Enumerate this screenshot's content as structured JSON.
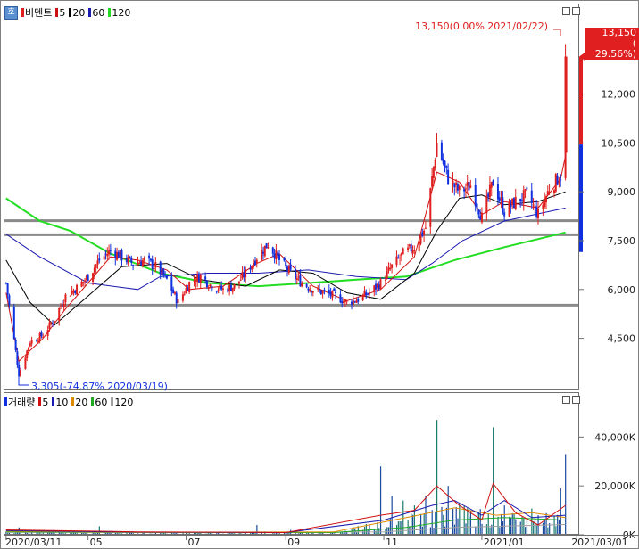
{
  "price_legend": {
    "icon": "호",
    "title": "비덴트",
    "ma5": "5",
    "ma20": "20",
    "ma60": "60",
    "ma120": "120"
  },
  "volume_legend": {
    "title": "거래량",
    "ma5": "5",
    "ma10": "10",
    "ma20": "20",
    "ma60": "60",
    "ma120": "120"
  },
  "annotations": {
    "high": "13,150(0.00% 2021/02/22)",
    "low": "3,305(-74.87% 2020/03/19)"
  },
  "current_price": {
    "price": "13,150",
    "change": "( 29.56%)"
  },
  "colors": {
    "up": "#e02020",
    "down": "#1030e0",
    "ma5": "#d01010",
    "ma20": "#000000",
    "ma60": "#1a1ab0",
    "ma120": "#22dd22",
    "volma20": "#e08a00",
    "volma120": "#a0a0a0",
    "hline": "#8a8a8a"
  },
  "chart_data": [
    {
      "type": "candlestick",
      "title": "비덴트",
      "y_ticks": [
        "12,000",
        "10,500",
        "9,000",
        "7,500",
        "6,000",
        "4,500"
      ],
      "y_tick_values": [
        12000,
        10500,
        9000,
        7500,
        6000,
        4500
      ],
      "ylim": [
        2930,
        14750
      ],
      "x_ticks": [
        "2020/03/11",
        "05",
        "07",
        "09",
        "11",
        "2021/01",
        "2021/03/01"
      ],
      "x_tick_dates": [
        "2020-03-11",
        "2020-05-01",
        "2020-07-01",
        "2020-09-01",
        "2020-11-01",
        "2021-01-01",
        "2021-03-01"
      ],
      "xlim": [
        "2020-03-10",
        "2021-03-02"
      ],
      "horizontal_lines": [
        8110,
        7680,
        5520
      ],
      "series_close": [
        [
          "2020-03-11",
          6200
        ],
        [
          "2020-03-19",
          3400
        ],
        [
          "2020-03-26",
          4400
        ],
        [
          "2020-04-03",
          4600
        ],
        [
          "2020-04-10",
          5100
        ],
        [
          "2020-04-17",
          5800
        ],
        [
          "2020-04-24",
          6050
        ],
        [
          "2020-05-01",
          6400
        ],
        [
          "2020-05-08",
          6900
        ],
        [
          "2020-05-15",
          7200
        ],
        [
          "2020-05-22",
          7000
        ],
        [
          "2020-05-29",
          6800
        ],
        [
          "2020-06-05",
          6900
        ],
        [
          "2020-06-12",
          6700
        ],
        [
          "2020-06-19",
          6300
        ],
        [
          "2020-06-26",
          5600
        ],
        [
          "2020-07-03",
          6200
        ],
        [
          "2020-07-10",
          6400
        ],
        [
          "2020-07-17",
          6100
        ],
        [
          "2020-07-24",
          6000
        ],
        [
          "2020-07-31",
          6100
        ],
        [
          "2020-08-07",
          6500
        ],
        [
          "2020-08-14",
          7000
        ],
        [
          "2020-08-21",
          7400
        ],
        [
          "2020-08-28",
          6900
        ],
        [
          "2020-09-04",
          6500
        ],
        [
          "2020-09-11",
          6200
        ],
        [
          "2020-09-18",
          6000
        ],
        [
          "2020-09-25",
          5900
        ],
        [
          "2020-10-02",
          5800
        ],
        [
          "2020-10-09",
          5600
        ],
        [
          "2020-10-16",
          5700
        ],
        [
          "2020-10-23",
          5900
        ],
        [
          "2020-10-30",
          6200
        ],
        [
          "2020-11-06",
          6700
        ],
        [
          "2020-11-13",
          7100
        ],
        [
          "2020-11-20",
          7300
        ],
        [
          "2020-11-27",
          7900
        ],
        [
          "2020-12-04",
          10500
        ],
        [
          "2020-12-11",
          9400
        ],
        [
          "2020-12-18",
          9000
        ],
        [
          "2020-12-25",
          9200
        ],
        [
          "2021-01-01",
          8200
        ],
        [
          "2021-01-08",
          9300
        ],
        [
          "2021-01-15",
          8400
        ],
        [
          "2021-01-22",
          8700
        ],
        [
          "2021-01-29",
          8900
        ],
        [
          "2021-02-05",
          8300
        ],
        [
          "2021-02-12",
          9100
        ],
        [
          "2021-02-19",
          9500
        ],
        [
          "2021-02-22",
          13150
        ]
      ],
      "ma5": [
        [
          "2020-03-11",
          5900
        ],
        [
          "2020-03-19",
          3800
        ],
        [
          "2020-04-03",
          4500
        ],
        [
          "2020-04-17",
          5400
        ],
        [
          "2020-05-01",
          6200
        ],
        [
          "2020-05-15",
          7000
        ],
        [
          "2020-06-01",
          6900
        ],
        [
          "2020-06-19",
          6600
        ],
        [
          "2020-07-03",
          6000
        ],
        [
          "2020-07-24",
          6100
        ],
        [
          "2020-08-14",
          6800
        ],
        [
          "2020-08-28",
          7100
        ],
        [
          "2020-09-18",
          6100
        ],
        [
          "2020-10-09",
          5650
        ],
        [
          "2020-10-30",
          6000
        ],
        [
          "2020-11-20",
          7000
        ],
        [
          "2020-12-04",
          9600
        ],
        [
          "2020-12-18",
          9300
        ],
        [
          "2021-01-01",
          8300
        ],
        [
          "2021-01-15",
          8700
        ],
        [
          "2021-02-05",
          8500
        ],
        [
          "2021-02-19",
          9400
        ],
        [
          "2021-02-22",
          10100
        ]
      ],
      "ma20": [
        [
          "2020-03-11",
          6900
        ],
        [
          "2020-03-26",
          5600
        ],
        [
          "2020-04-10",
          4900
        ],
        [
          "2020-05-01",
          5800
        ],
        [
          "2020-05-22",
          6700
        ],
        [
          "2020-06-19",
          6800
        ],
        [
          "2020-07-10",
          6300
        ],
        [
          "2020-08-07",
          6100
        ],
        [
          "2020-08-28",
          6600
        ],
        [
          "2020-09-18",
          6500
        ],
        [
          "2020-10-09",
          5900
        ],
        [
          "2020-10-30",
          5700
        ],
        [
          "2020-11-20",
          6500
        ],
        [
          "2020-12-04",
          7800
        ],
        [
          "2020-12-18",
          8800
        ],
        [
          "2021-01-01",
          8900
        ],
        [
          "2021-01-15",
          8600
        ],
        [
          "2021-02-05",
          8700
        ],
        [
          "2021-02-22",
          9000
        ]
      ],
      "ma60": [
        [
          "2020-03-11",
          7700
        ],
        [
          "2020-04-01",
          7000
        ],
        [
          "2020-05-01",
          6200
        ],
        [
          "2020-06-01",
          6000
        ],
        [
          "2020-06-15",
          6400
        ],
        [
          "2020-07-15",
          6500
        ],
        [
          "2020-08-15",
          6500
        ],
        [
          "2020-09-15",
          6600
        ],
        [
          "2020-10-15",
          6400
        ],
        [
          "2020-11-15",
          6300
        ],
        [
          "2020-12-01",
          6800
        ],
        [
          "2020-12-20",
          7500
        ],
        [
          "2021-01-15",
          8100
        ],
        [
          "2021-02-22",
          8500
        ]
      ],
      "ma120": [
        [
          "2020-03-11",
          8800
        ],
        [
          "2020-04-01",
          8100
        ],
        [
          "2020-04-20",
          7800
        ],
        [
          "2020-05-15",
          7100
        ],
        [
          "2020-06-15",
          6500
        ],
        [
          "2020-07-15",
          6200
        ],
        [
          "2020-08-15",
          6100
        ],
        [
          "2020-09-15",
          6200
        ],
        [
          "2020-10-15",
          6300
        ],
        [
          "2020-11-15",
          6400
        ],
        [
          "2020-12-15",
          6900
        ],
        [
          "2021-01-15",
          7300
        ],
        [
          "2021-02-22",
          7750
        ]
      ]
    },
    {
      "type": "bar",
      "title": "거래량",
      "y_ticks": [
        "40,000K",
        "20,000K",
        "0K"
      ],
      "y_tick_values": [
        40000,
        20000,
        0
      ],
      "ylim": [
        0,
        58000
      ],
      "unit": "K",
      "spikes": [
        [
          "2020-03-19",
          3000
        ],
        [
          "2020-05-08",
          3500
        ],
        [
          "2020-08-14",
          4000
        ],
        [
          "2020-09-04",
          2000
        ],
        [
          "2020-10-30",
          28000
        ],
        [
          "2020-11-06",
          16000
        ],
        [
          "2020-11-13",
          14000
        ],
        [
          "2020-11-20",
          12000
        ],
        [
          "2020-11-27",
          16000
        ],
        [
          "2020-12-04",
          47000
        ],
        [
          "2020-12-11",
          20000
        ],
        [
          "2020-12-18",
          13000
        ],
        [
          "2020-12-25",
          10000
        ],
        [
          "2021-01-08",
          44000
        ],
        [
          "2021-01-15",
          12000
        ],
        [
          "2021-02-05",
          8000
        ],
        [
          "2021-02-19",
          19000
        ],
        [
          "2021-02-22",
          33000
        ]
      ],
      "ma5": [
        [
          "2020-03-11",
          2000
        ],
        [
          "2020-06-01",
          1200
        ],
        [
          "2020-09-01",
          900
        ],
        [
          "2020-10-30",
          8000
        ],
        [
          "2020-11-20",
          10000
        ],
        [
          "2020-12-04",
          20000
        ],
        [
          "2020-12-18",
          12000
        ],
        [
          "2021-01-01",
          6000
        ],
        [
          "2021-01-08",
          21000
        ],
        [
          "2021-01-22",
          9000
        ],
        [
          "2021-02-05",
          4000
        ],
        [
          "2021-02-22",
          12000
        ]
      ],
      "ma10": [
        [
          "2020-03-11",
          1700
        ],
        [
          "2020-06-01",
          1100
        ],
        [
          "2020-09-01",
          900
        ],
        [
          "2020-11-01",
          6000
        ],
        [
          "2020-12-01",
          12000
        ],
        [
          "2020-12-15",
          14000
        ],
        [
          "2021-01-01",
          8000
        ],
        [
          "2021-01-15",
          14000
        ],
        [
          "2021-02-01",
          7000
        ],
        [
          "2021-02-22",
          8000
        ]
      ],
      "ma20": [
        [
          "2020-03-11",
          1500
        ],
        [
          "2020-06-01",
          1000
        ],
        [
          "2020-10-01",
          1200
        ],
        [
          "2020-11-15",
          7000
        ],
        [
          "2020-12-15",
          11000
        ],
        [
          "2021-01-10",
          8000
        ],
        [
          "2021-02-01",
          9000
        ],
        [
          "2021-02-22",
          7000
        ]
      ],
      "ma60": [
        [
          "2020-03-11",
          1200
        ],
        [
          "2020-06-01",
          1000
        ],
        [
          "2020-10-01",
          900
        ],
        [
          "2020-11-15",
          3000
        ],
        [
          "2020-12-15",
          6000
        ],
        [
          "2021-01-15",
          7000
        ],
        [
          "2021-02-22",
          6000
        ]
      ],
      "ma120": [
        [
          "2020-03-11",
          1000
        ],
        [
          "2020-07-01",
          900
        ],
        [
          "2020-11-01",
          1200
        ],
        [
          "2020-12-15",
          3000
        ],
        [
          "2021-02-22",
          4200
        ]
      ]
    }
  ]
}
